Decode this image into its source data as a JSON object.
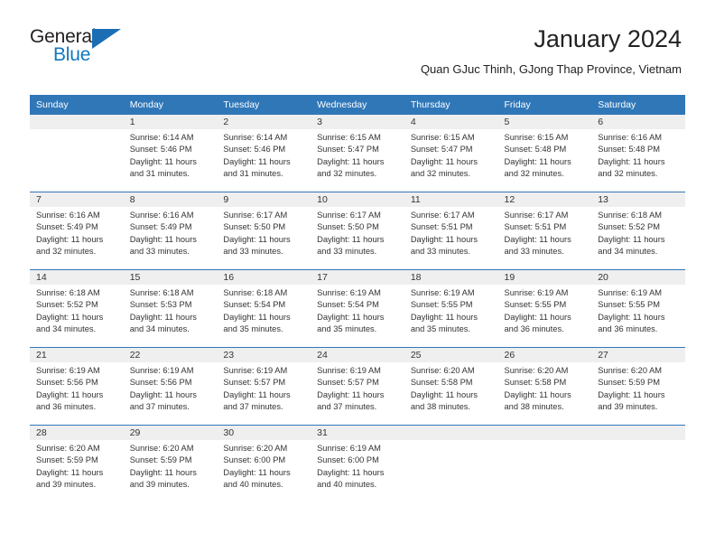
{
  "brand": {
    "name_part1": "General",
    "name_part2": "Blue",
    "logo_icon": "triangle-logo-icon",
    "accent_color": "#1278be"
  },
  "header": {
    "title": "January 2024",
    "subtitle": "Quan GJuc Thinh, GJong Thap Province, Vietnam"
  },
  "theme": {
    "header_blue": "#3077b8",
    "daynum_band": "#efefef",
    "text": "#333333"
  },
  "calendar": {
    "weekdays": [
      "Sunday",
      "Monday",
      "Tuesday",
      "Wednesday",
      "Thursday",
      "Friday",
      "Saturday"
    ],
    "weeks": [
      [
        {
          "day": "",
          "sunrise": "",
          "sunset": "",
          "daylight1": "",
          "daylight2": ""
        },
        {
          "day": "1",
          "sunrise": "Sunrise: 6:14 AM",
          "sunset": "Sunset: 5:46 PM",
          "daylight1": "Daylight: 11 hours",
          "daylight2": "and 31 minutes."
        },
        {
          "day": "2",
          "sunrise": "Sunrise: 6:14 AM",
          "sunset": "Sunset: 5:46 PM",
          "daylight1": "Daylight: 11 hours",
          "daylight2": "and 31 minutes."
        },
        {
          "day": "3",
          "sunrise": "Sunrise: 6:15 AM",
          "sunset": "Sunset: 5:47 PM",
          "daylight1": "Daylight: 11 hours",
          "daylight2": "and 32 minutes."
        },
        {
          "day": "4",
          "sunrise": "Sunrise: 6:15 AM",
          "sunset": "Sunset: 5:47 PM",
          "daylight1": "Daylight: 11 hours",
          "daylight2": "and 32 minutes."
        },
        {
          "day": "5",
          "sunrise": "Sunrise: 6:15 AM",
          "sunset": "Sunset: 5:48 PM",
          "daylight1": "Daylight: 11 hours",
          "daylight2": "and 32 minutes."
        },
        {
          "day": "6",
          "sunrise": "Sunrise: 6:16 AM",
          "sunset": "Sunset: 5:48 PM",
          "daylight1": "Daylight: 11 hours",
          "daylight2": "and 32 minutes."
        }
      ],
      [
        {
          "day": "7",
          "sunrise": "Sunrise: 6:16 AM",
          "sunset": "Sunset: 5:49 PM",
          "daylight1": "Daylight: 11 hours",
          "daylight2": "and 32 minutes."
        },
        {
          "day": "8",
          "sunrise": "Sunrise: 6:16 AM",
          "sunset": "Sunset: 5:49 PM",
          "daylight1": "Daylight: 11 hours",
          "daylight2": "and 33 minutes."
        },
        {
          "day": "9",
          "sunrise": "Sunrise: 6:17 AM",
          "sunset": "Sunset: 5:50 PM",
          "daylight1": "Daylight: 11 hours",
          "daylight2": "and 33 minutes."
        },
        {
          "day": "10",
          "sunrise": "Sunrise: 6:17 AM",
          "sunset": "Sunset: 5:50 PM",
          "daylight1": "Daylight: 11 hours",
          "daylight2": "and 33 minutes."
        },
        {
          "day": "11",
          "sunrise": "Sunrise: 6:17 AM",
          "sunset": "Sunset: 5:51 PM",
          "daylight1": "Daylight: 11 hours",
          "daylight2": "and 33 minutes."
        },
        {
          "day": "12",
          "sunrise": "Sunrise: 6:17 AM",
          "sunset": "Sunset: 5:51 PM",
          "daylight1": "Daylight: 11 hours",
          "daylight2": "and 33 minutes."
        },
        {
          "day": "13",
          "sunrise": "Sunrise: 6:18 AM",
          "sunset": "Sunset: 5:52 PM",
          "daylight1": "Daylight: 11 hours",
          "daylight2": "and 34 minutes."
        }
      ],
      [
        {
          "day": "14",
          "sunrise": "Sunrise: 6:18 AM",
          "sunset": "Sunset: 5:52 PM",
          "daylight1": "Daylight: 11 hours",
          "daylight2": "and 34 minutes."
        },
        {
          "day": "15",
          "sunrise": "Sunrise: 6:18 AM",
          "sunset": "Sunset: 5:53 PM",
          "daylight1": "Daylight: 11 hours",
          "daylight2": "and 34 minutes."
        },
        {
          "day": "16",
          "sunrise": "Sunrise: 6:18 AM",
          "sunset": "Sunset: 5:54 PM",
          "daylight1": "Daylight: 11 hours",
          "daylight2": "and 35 minutes."
        },
        {
          "day": "17",
          "sunrise": "Sunrise: 6:19 AM",
          "sunset": "Sunset: 5:54 PM",
          "daylight1": "Daylight: 11 hours",
          "daylight2": "and 35 minutes."
        },
        {
          "day": "18",
          "sunrise": "Sunrise: 6:19 AM",
          "sunset": "Sunset: 5:55 PM",
          "daylight1": "Daylight: 11 hours",
          "daylight2": "and 35 minutes."
        },
        {
          "day": "19",
          "sunrise": "Sunrise: 6:19 AM",
          "sunset": "Sunset: 5:55 PM",
          "daylight1": "Daylight: 11 hours",
          "daylight2": "and 36 minutes."
        },
        {
          "day": "20",
          "sunrise": "Sunrise: 6:19 AM",
          "sunset": "Sunset: 5:55 PM",
          "daylight1": "Daylight: 11 hours",
          "daylight2": "and 36 minutes."
        }
      ],
      [
        {
          "day": "21",
          "sunrise": "Sunrise: 6:19 AM",
          "sunset": "Sunset: 5:56 PM",
          "daylight1": "Daylight: 11 hours",
          "daylight2": "and 36 minutes."
        },
        {
          "day": "22",
          "sunrise": "Sunrise: 6:19 AM",
          "sunset": "Sunset: 5:56 PM",
          "daylight1": "Daylight: 11 hours",
          "daylight2": "and 37 minutes."
        },
        {
          "day": "23",
          "sunrise": "Sunrise: 6:19 AM",
          "sunset": "Sunset: 5:57 PM",
          "daylight1": "Daylight: 11 hours",
          "daylight2": "and 37 minutes."
        },
        {
          "day": "24",
          "sunrise": "Sunrise: 6:19 AM",
          "sunset": "Sunset: 5:57 PM",
          "daylight1": "Daylight: 11 hours",
          "daylight2": "and 37 minutes."
        },
        {
          "day": "25",
          "sunrise": "Sunrise: 6:20 AM",
          "sunset": "Sunset: 5:58 PM",
          "daylight1": "Daylight: 11 hours",
          "daylight2": "and 38 minutes."
        },
        {
          "day": "26",
          "sunrise": "Sunrise: 6:20 AM",
          "sunset": "Sunset: 5:58 PM",
          "daylight1": "Daylight: 11 hours",
          "daylight2": "and 38 minutes."
        },
        {
          "day": "27",
          "sunrise": "Sunrise: 6:20 AM",
          "sunset": "Sunset: 5:59 PM",
          "daylight1": "Daylight: 11 hours",
          "daylight2": "and 39 minutes."
        }
      ],
      [
        {
          "day": "28",
          "sunrise": "Sunrise: 6:20 AM",
          "sunset": "Sunset: 5:59 PM",
          "daylight1": "Daylight: 11 hours",
          "daylight2": "and 39 minutes."
        },
        {
          "day": "29",
          "sunrise": "Sunrise: 6:20 AM",
          "sunset": "Sunset: 5:59 PM",
          "daylight1": "Daylight: 11 hours",
          "daylight2": "and 39 minutes."
        },
        {
          "day": "30",
          "sunrise": "Sunrise: 6:20 AM",
          "sunset": "Sunset: 6:00 PM",
          "daylight1": "Daylight: 11 hours",
          "daylight2": "and 40 minutes."
        },
        {
          "day": "31",
          "sunrise": "Sunrise: 6:19 AM",
          "sunset": "Sunset: 6:00 PM",
          "daylight1": "Daylight: 11 hours",
          "daylight2": "and 40 minutes."
        },
        {
          "day": "",
          "sunrise": "",
          "sunset": "",
          "daylight1": "",
          "daylight2": ""
        },
        {
          "day": "",
          "sunrise": "",
          "sunset": "",
          "daylight1": "",
          "daylight2": ""
        },
        {
          "day": "",
          "sunrise": "",
          "sunset": "",
          "daylight1": "",
          "daylight2": ""
        }
      ]
    ]
  }
}
